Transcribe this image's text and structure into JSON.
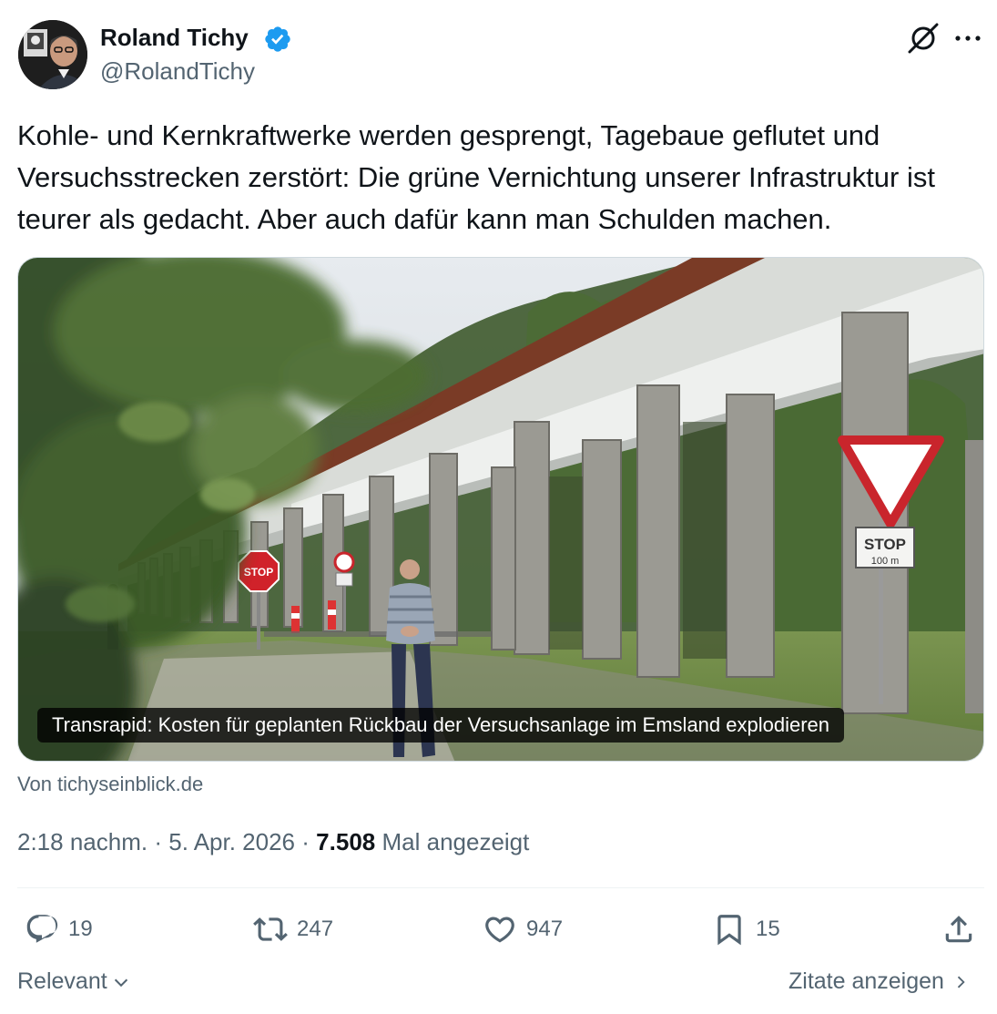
{
  "author": {
    "name": "Roland Tichy",
    "handle": "@RolandTichy",
    "verified": true,
    "verified_color": "#1d9bf0"
  },
  "icons": [
    "grok-icon",
    "more-icon",
    "reply-icon",
    "retweet-icon",
    "like-icon",
    "bookmark-icon",
    "share-icon",
    "chevron-down-icon",
    "chevron-right-icon"
  ],
  "tweet": {
    "text": "Kohle- und Kernkraftwerke werden gesprengt, Tagebaue geflutet und Versuchsstrecken zerstört: Die grüne Vernichtung unserer Infrastruktur ist teurer als gedacht. Aber auch dafür kann man Schulden machen."
  },
  "card": {
    "caption": "Transrapid: Kosten für geplanten Rückbau der Versuchsanlage im Emsland explodieren",
    "source": "Von tichyseinblick.de",
    "sign_stop_left": "STOP",
    "sign_stop_right": "STOP",
    "sign_stop_right_sub": "100 m"
  },
  "meta": {
    "time": "2:18 nachm.",
    "sep1": "·",
    "date": "5. Apr. 2026",
    "sep2": "·",
    "views": "7.508",
    "views_label": "Mal angezeigt"
  },
  "actions": {
    "replies": "19",
    "retweets": "247",
    "likes": "947",
    "bookmarks": "15"
  },
  "footer": {
    "sort_label": "Relevant",
    "quotes_label": "Zitate anzeigen"
  }
}
